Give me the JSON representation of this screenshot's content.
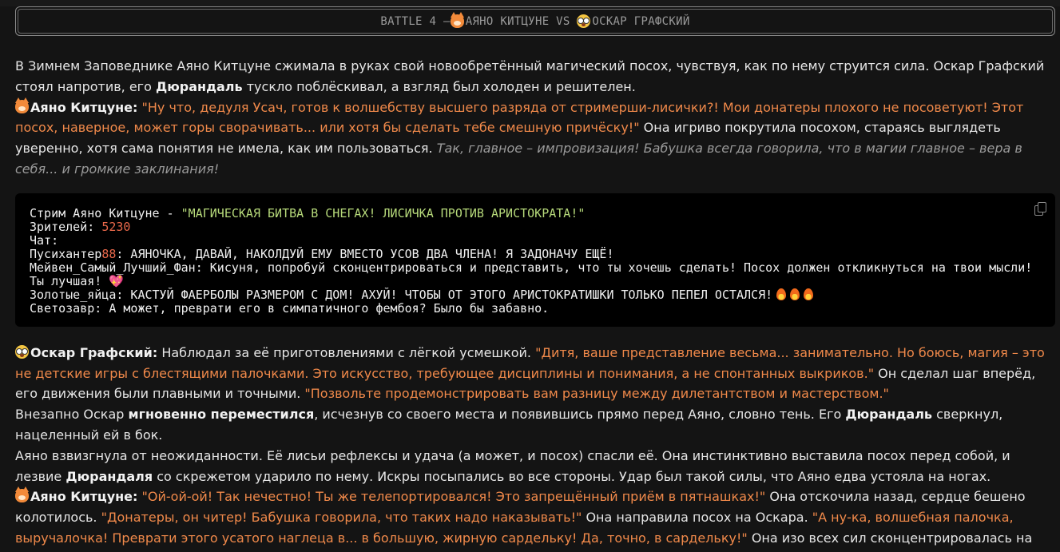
{
  "banner": {
    "battle": "BATTLE 4 – ",
    "name1": "АЯНО КИТЦУНЕ",
    "vs": " VS ",
    "name2": "ОСКАР ГРАФСКИЙ"
  },
  "story": {
    "p1": "В Зимнем Заповеднике Аяно Китцуне сжимала в руках свой новообретённый магический посох, чувствуя, как по нему струится сила. Оскар Графский стоял напротив, его ",
    "p1_b": "Дюрандаль",
    "p1_end": " тускло поблёскивал, а взгляд был холоден и решителен.",
    "ayano_label": "Аяно Китцуне:",
    "ayano_q1": " \"Ну что, дедуля Усач, готов к волшебству высшего разряда от стримерши-лисички?! Мои донатеры плохого не посоветуют! Этот посох, наверное, может горы сворачивать... или хотя бы сделать тебе смешную причёску!\"",
    "ayano_t1": " Она игриво покрутила посохом, стараясь выглядеть уверенно, хотя сама понятия не имела, как им пользоваться. ",
    "ayano_thought": "Так, главное – импровизация! Бабушка всегда говорила, что в магии главное – вера в себя... и громкие заклинания!"
  },
  "stream": {
    "title_label": "Стрим Аяно Китцуне - ",
    "title_text": "\"МАГИЧЕСКАЯ БИТВА В СНЕГАХ! ЛИСИЧКА ПРОТИВ АРИСТОКРАТА!\"",
    "viewers_label": "Зрителей: ",
    "viewers_value": "5230",
    "chat_label": "Чат:",
    "m1_user": "Пусихантер",
    "m1_num": "88",
    "m1_text": ": АЯНОЧКА, ДАВАЙ, НАКОЛДУЙ ЕМУ ВМЕСТО УСОВ ДВА ЧЛЕНА! Я ЗАДОНАЧУ ЕЩЁ!",
    "m2": "Мейвен_Самый_Лучший_Фан: Кисуня, попробуй сконцентрироваться и представить, что ты хочешь сделать! Посох должен откликнуться на твои мысли! Ты лучшая! ",
    "m2_heart": "💖",
    "m3": "Золотые_яйца: КАСТУЙ ФАЕРБОЛЫ РАЗМЕРОМ С ДОМ! АХУЙ! ЧТОБЫ ОТ ЭТОГО АРИСТОКРАТИШКИ ТОЛЬКО ПЕПЕЛ ОСТАЛСЯ!",
    "m4": "Светозавр: А может, преврати его в симпатичного фембоя? Было бы забавно."
  },
  "story2": {
    "oscar_label": "Оскар Графский:",
    "oscar_t1": " Наблюдал за её приготовлениями с лёгкой усмешкой. ",
    "oscar_q1": "\"Дитя, ваше представление весьма... занимательно. Но боюсь, магия – это не детские игры с блестящими палочками. Это искусство, требующее дисциплины и понимания, а не спонтанных выкриков.\"",
    "oscar_t2": " Он сделал шаг вперёд, его движения были плавными и точными. ",
    "oscar_q2": "\"Позвольте продемонстрировать вам разницу между дилетантством и мастерством.\"",
    "p2a": "Внезапно Оскар ",
    "p2b": "мгновенно переместился",
    "p2c": ", исчезнув со своего места и появившись прямо перед Аяно, словно тень. Его ",
    "p2d": "Дюрандаль",
    "p2e": " сверкнул, нацеленный ей в бок.",
    "p3a": "Аяно взвизгнула от неожиданности. Её лисьи рефлексы и удача (а может, и посох) спасли её. Она инстинктивно выставила посох перед собой, и лезвие ",
    "p3b": "Дюрандаля",
    "p3c": " со скрежетом ударило по нему. Искры посыпались во все стороны. Удар был такой силы, что Аяно едва устояла на ногах.",
    "ayano_label": "Аяно Китцуне:",
    "a_q1": " \"Ой-ой-ой! Так нечестно! Ты же телепортировался! Это запрещённый приём в пятнашках!\"",
    "a_t1": " Она отскочила назад, сердце бешено колотилось. ",
    "a_q2": "\"Донатеры, он читер! Бабушка говорила, что таких надо наказывать!\"",
    "a_t2": " Она направила посох на Оскара. ",
    "a_q3": "\"А ну-ка, волшебная палочка, выручалочка! Преврати этого усатого наглеца в... в большую, жирную сардельку! Да, точно, в сардельку!\"",
    "a_t3": " Она изо всех сил сконцентрировалась на"
  },
  "icons": {
    "fox": "fox-face-icon",
    "oscar": "monocle-face-icon",
    "copy": "copy-icon",
    "fire": "fire-icon"
  },
  "colors": {
    "quote": "#f0894a",
    "code_green": "#b6d97a",
    "code_number": "#e8684a",
    "background": "#141414"
  }
}
